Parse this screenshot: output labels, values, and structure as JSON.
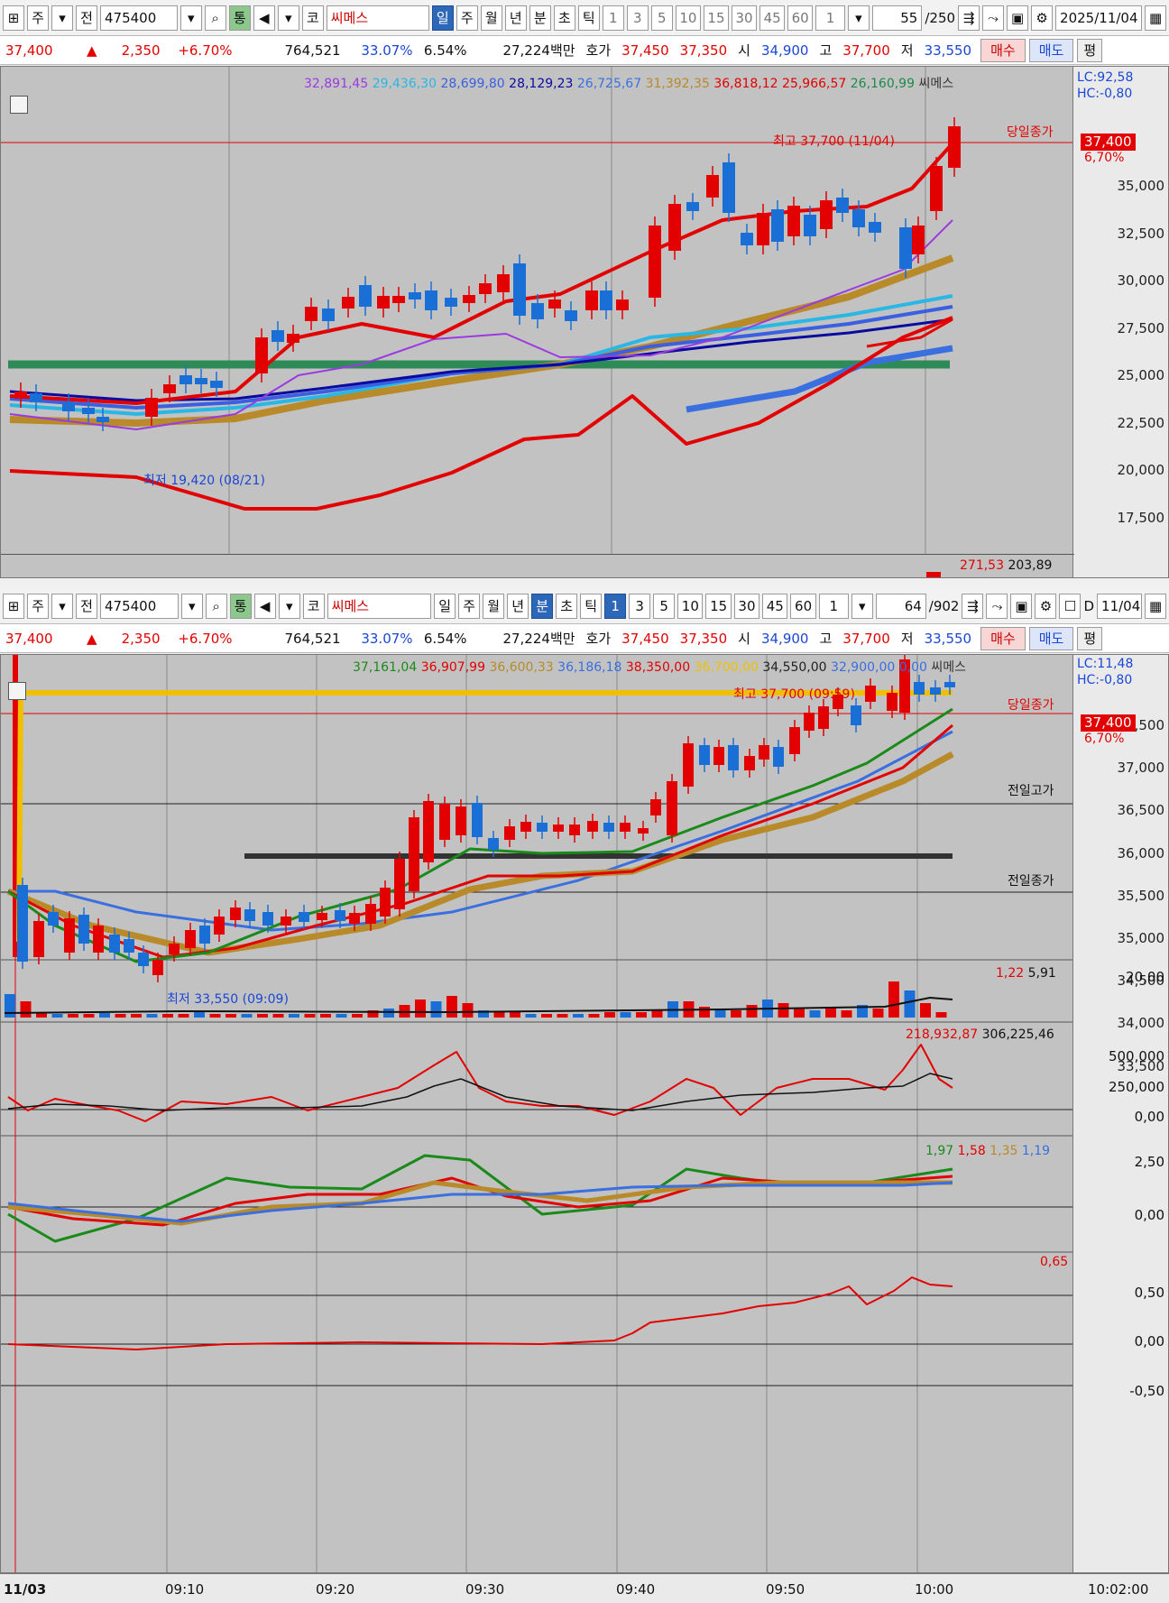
{
  "daily": {
    "toolbar": {
      "items": [
        "주",
        "전",
        "475400",
        "통",
        "코",
        "씨메스",
        "일",
        "주",
        "월",
        "년",
        "분",
        "초",
        "틱",
        "1",
        "3",
        "5",
        "10",
        "15",
        "30",
        "45",
        "60",
        "1"
      ],
      "count": "55",
      "total": "/250",
      "date": "2025/11/04",
      "active": "일"
    },
    "quote": {
      "price": "37,400",
      "change": "2,350",
      "pct": "+6.70%",
      "volume": "764,521",
      "ratio": "33.07%",
      "turnover": "6.54%",
      "amount": "27,224백만",
      "hoga_label": "호가",
      "ask": "37,450",
      "bid": "37,350",
      "open_label": "시",
      "open": "34,900",
      "high_label": "고",
      "high": "37,700",
      "low_label": "저",
      "low": "33,550",
      "buy": "매수",
      "sell": "매도",
      "avg": "평"
    },
    "legend": [
      "32,891,45",
      "29,436,30",
      "28,699,80",
      "28,129,23",
      "26,725,67",
      "31,392,35",
      "36,818,12",
      "25,966,57",
      "26,160,99",
      "씨메스"
    ],
    "lc": "LC:92,58",
    "hc": "HC:-0,80",
    "yticks": [
      "35,000",
      "32,500",
      "30,000",
      "27,500",
      "25,000",
      "22,500",
      "20,000",
      "17,500"
    ],
    "close_label": "당일종가",
    "close_badge": "37,400",
    "close_pct": "6,70%",
    "high_note": "최고 37,700 (11/04)",
    "low_note": "최저 19,420 (08/21)",
    "vol_legend_a": "271,53",
    "vol_legend_b": "203,89"
  },
  "minute": {
    "toolbar": {
      "count": "64",
      "total": "/902",
      "date": "11/04",
      "active": "분",
      "interval": "1",
      "d_label": "D"
    },
    "legend": [
      "37,161,04",
      "36,907,99",
      "36,600,33",
      "36,186,18",
      "38,350,00",
      "36,700,00",
      "34,550,00",
      "32,900,00",
      "0,00",
      "씨메스"
    ],
    "lc": "LC:11,48",
    "hc": "HC:-0,80",
    "yticks": [
      "37,500",
      "37,000",
      "36,500",
      "36,000",
      "35,500",
      "35,000",
      "34,500",
      "34,000",
      "33,500"
    ],
    "close_label": "당일종가",
    "prev_high_label": "전일고가",
    "prev_close_label": "전일종가",
    "close_badge": "37,400",
    "close_pct": "6,70%",
    "high_note": "최고 37,700 (09:59)",
    "low_note": "최저 33,550 (09:09)",
    "vol": {
      "a": "1,22",
      "b": "5,91",
      "tick": "20,00"
    },
    "obv": {
      "a": "218,932,87",
      "b": "306,225,46",
      "ticks": [
        "500,000",
        "250,000",
        "0,00"
      ]
    },
    "macd": {
      "a": "1,97",
      "b": "1,58",
      "c": "1,35",
      "d": "1,19",
      "ticks": [
        "2,50",
        "0,00"
      ]
    },
    "ind": {
      "a": "0,65",
      "ticks": [
        "0,50",
        "0,00",
        "-0,50"
      ]
    }
  },
  "time_axis": [
    "11/03",
    "09:10",
    "09:20",
    "09:30",
    "09:40",
    "09:50",
    "10:00",
    "10:02:00"
  ],
  "colors": {
    "up": "#e30000",
    "down": "#1a6fd6",
    "bg": "#c2c2c2"
  }
}
